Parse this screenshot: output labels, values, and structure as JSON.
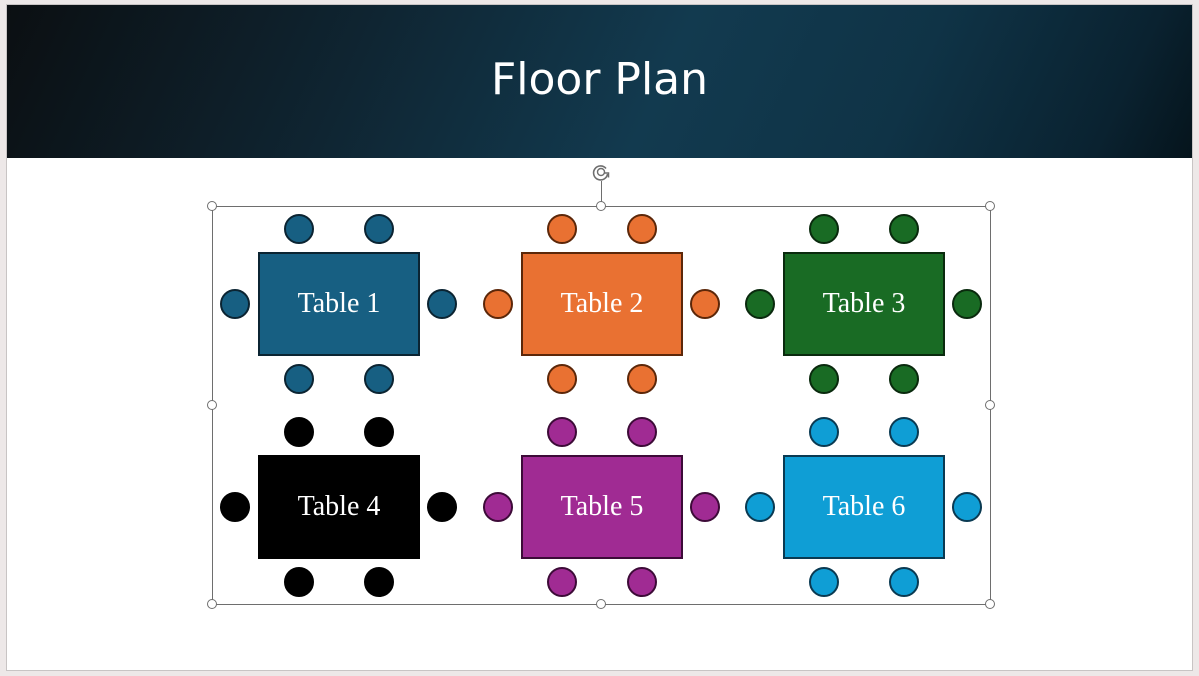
{
  "slide": {
    "title": "Floor Plan"
  },
  "tables": [
    {
      "label": "Table 1",
      "fill": "#175f82",
      "border": "#0b2432",
      "chairs": 6
    },
    {
      "label": "Table 2",
      "fill": "#e97132",
      "border": "#5c2709",
      "chairs": 6
    },
    {
      "label": "Table 3",
      "fill": "#196b24",
      "border": "#0a2a0e",
      "chairs": 6
    },
    {
      "label": "Table 4",
      "fill": "#000000",
      "border": "#000000",
      "chairs": 6
    },
    {
      "label": "Table 5",
      "fill": "#a02b93",
      "border": "#3d0b38",
      "chairs": 6
    },
    {
      "label": "Table 6",
      "fill": "#0f9ed5",
      "border": "#0a3a52",
      "chairs": 6
    }
  ],
  "selection": {
    "handles": [
      "top-left",
      "top-center",
      "top-right",
      "middle-left",
      "middle-right",
      "bottom-left",
      "bottom-center",
      "bottom-right"
    ],
    "rotate_handle": "rotate-icon"
  }
}
